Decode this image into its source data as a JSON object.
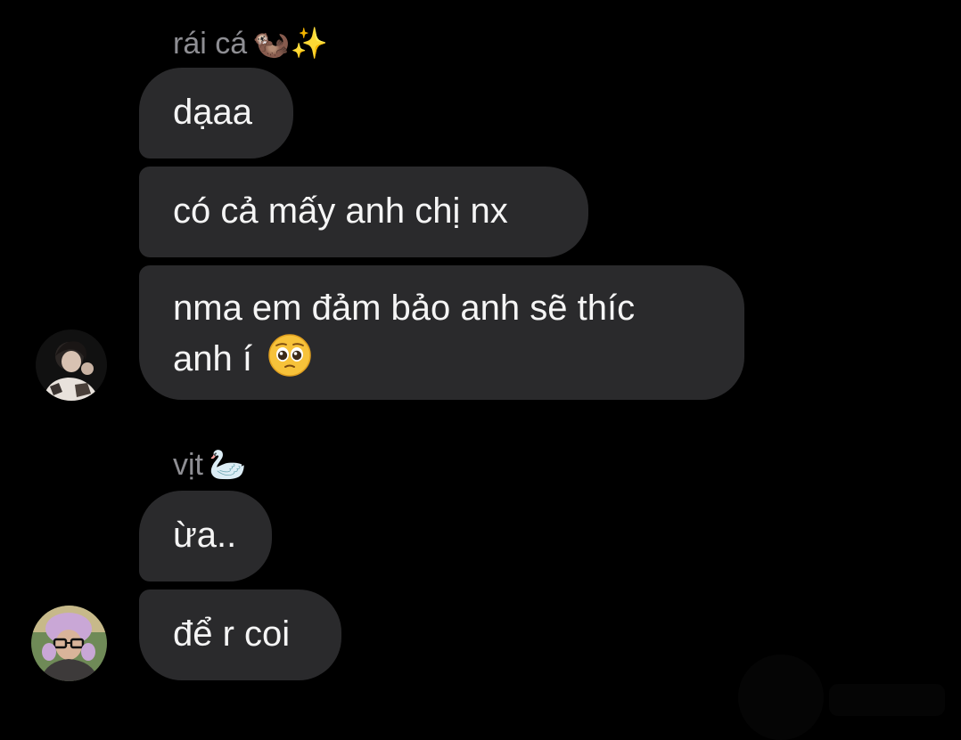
{
  "conversation": {
    "groups": [
      {
        "sender": {
          "name": "rái cá",
          "name_emoji": "🦦✨"
        },
        "messages": [
          {
            "text": "dạaa"
          },
          {
            "text": "có cả mấy anh chị nx"
          },
          {
            "line1": "nma em đảm bảo anh sẽ thíc",
            "line2": "anh í",
            "emoji": "🥺"
          }
        ]
      },
      {
        "sender": {
          "name": "vịt",
          "name_emoji": "🦢"
        },
        "messages": [
          {
            "text": "ừa.."
          },
          {
            "text": "để r coi"
          }
        ]
      }
    ]
  },
  "colors": {
    "background": "#000000",
    "bubble": "#2a2a2c",
    "message_text": "#f5f5f5",
    "sender_name": "#8e8e93"
  }
}
